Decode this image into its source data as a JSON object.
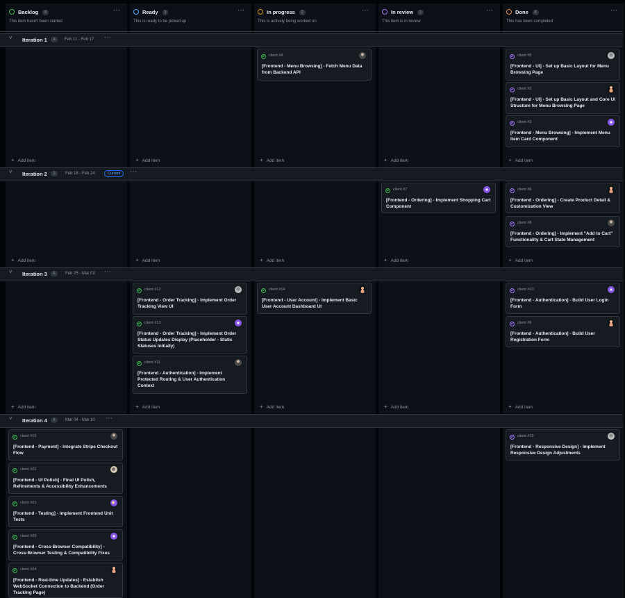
{
  "columns": [
    {
      "id": "backlog",
      "title": "Backlog",
      "count": "8",
      "desc": "This item hasn't been started",
      "color": "#3fb950"
    },
    {
      "id": "ready",
      "title": "Ready",
      "count": "3",
      "desc": "This is ready to be picked up",
      "color": "#58a6ff"
    },
    {
      "id": "inprogress",
      "title": "In progress",
      "count": "2",
      "desc": "This is actively being worked on",
      "color": "#d29922"
    },
    {
      "id": "inreview",
      "title": "In review",
      "count": "1",
      "desc": "This item is in review",
      "color": "#a371f7"
    },
    {
      "id": "done",
      "title": "Done",
      "count": "8",
      "desc": "This has been completed",
      "color": "#f0883e"
    }
  ],
  "add_item_label": "Add item",
  "groups": [
    {
      "name": "Iteration 1",
      "count": "4",
      "dates": "Feb 11 - Feb 17",
      "badge": "",
      "cards": [
        [],
        [],
        [
          {
            "num": "client #4",
            "title": "[Frontend - Menu Browsing] - Fetch Menu Data from Backend API",
            "avatar": "photo-dark",
            "status": "open"
          }
        ],
        [],
        [
          {
            "num": "client #5",
            "title": "[Frontend - UI] - Set up Basic Layout for Menu Browsing Page",
            "avatar": "photo-gray",
            "status": "done"
          },
          {
            "num": "client #2",
            "title": "[Frontend - UI] - Set up Basic Layout and Core UI Structure for Menu Browsing Page",
            "avatar": "figure-peach",
            "status": "done"
          },
          {
            "num": "client #3",
            "title": "[Frontend - Menu Browsing] - Implement Menu Item Card Component",
            "avatar": "logo-purple",
            "status": "done"
          }
        ]
      ]
    },
    {
      "name": "Iteration 2",
      "count": "3",
      "dates": "Feb 18 - Feb 24",
      "badge": "Current",
      "cards": [
        [],
        [],
        [],
        [
          {
            "num": "client #7",
            "title": "[Frontend - Ordering] - Implement Shopping Cart Component",
            "avatar": "logo-purple",
            "status": "open"
          }
        ],
        [
          {
            "num": "client #6",
            "title": "[Frontend - Ordering] - Create Product Detail & Customization View",
            "avatar": "figure-peach",
            "status": "done"
          },
          {
            "num": "client #8",
            "title": "[Frontend - Ordering] - Implement \"Add to Cart\" Functionality & Cart State Management",
            "avatar": "photo-dark",
            "status": "done"
          }
        ]
      ]
    },
    {
      "name": "Iteration 3",
      "count": "6",
      "dates": "Feb 25 - Mar 03",
      "badge": "",
      "cards": [
        [],
        [
          {
            "num": "client #12",
            "title": "[Frontend - Order Tracking] - Implement Order Tracking View UI",
            "avatar": "photo-gray",
            "status": "open"
          },
          {
            "num": "client #13",
            "title": "[Frontend - Order Tracking] - Implement Order Status Updates Display (Placeholder - Static Statuses Initially)",
            "avatar": "logo-purple",
            "status": "open"
          },
          {
            "num": "client #11",
            "title": "[Frontend - Authentication] - Implement Protected Routing & User Authentication Context",
            "avatar": "photo-dark",
            "status": "open"
          }
        ],
        [
          {
            "num": "client #14",
            "title": "[Frontend - User Account] - Implement Basic User Account Dashboard UI",
            "avatar": "figure-peach",
            "status": "open"
          }
        ],
        [],
        [
          {
            "num": "client #10",
            "title": "[Frontend - Authentication] - Build User Login Form",
            "avatar": "logo-purple",
            "status": "done"
          },
          {
            "num": "client #9",
            "title": "[Frontend - Authentication] - Build User Registration Form",
            "avatar": "figure-peach",
            "status": "done"
          }
        ]
      ]
    },
    {
      "name": "Iteration 4",
      "count": "9",
      "dates": "Mar 04 - Mar 10",
      "badge": "",
      "cards": [
        [
          {
            "num": "client #15",
            "title": "[Frontend - Payment] - Integrate Stripe Checkout Flow",
            "avatar": "photo-dark",
            "status": "open"
          },
          {
            "num": "client #22",
            "title": "[Frontend - UI Polish] - Final UI Polish, Refinements & Accessibility Enhancements",
            "avatar": "photo-tan",
            "status": "open"
          },
          {
            "num": "client #21",
            "title": "[Frontend - Testing] - Implement Frontend Unit Tests",
            "avatar": "logo-purple-face",
            "status": "open"
          },
          {
            "num": "client #20",
            "title": "[Frontend - Cross-Browser Compatibility] - Cross-Browser Testing & Compatibility Fixes",
            "avatar": "logo-purple",
            "status": "open"
          },
          {
            "num": "client #24",
            "title": "[Frontend - Real-time Updates] - Establish WebSocket Connection to Backend (Order Tracking Page)",
            "avatar": "figure-peach",
            "status": "open"
          }
        ],
        [],
        [],
        [],
        [
          {
            "num": "client #19",
            "title": "[Frontend - Responsive Design] - Implement Responsive Design Adjustments",
            "avatar": "photo-gray",
            "status": "done"
          }
        ]
      ]
    }
  ],
  "colors": {
    "open": "#3fb950",
    "done": "#a371f7",
    "accent": "#58a6ff"
  }
}
